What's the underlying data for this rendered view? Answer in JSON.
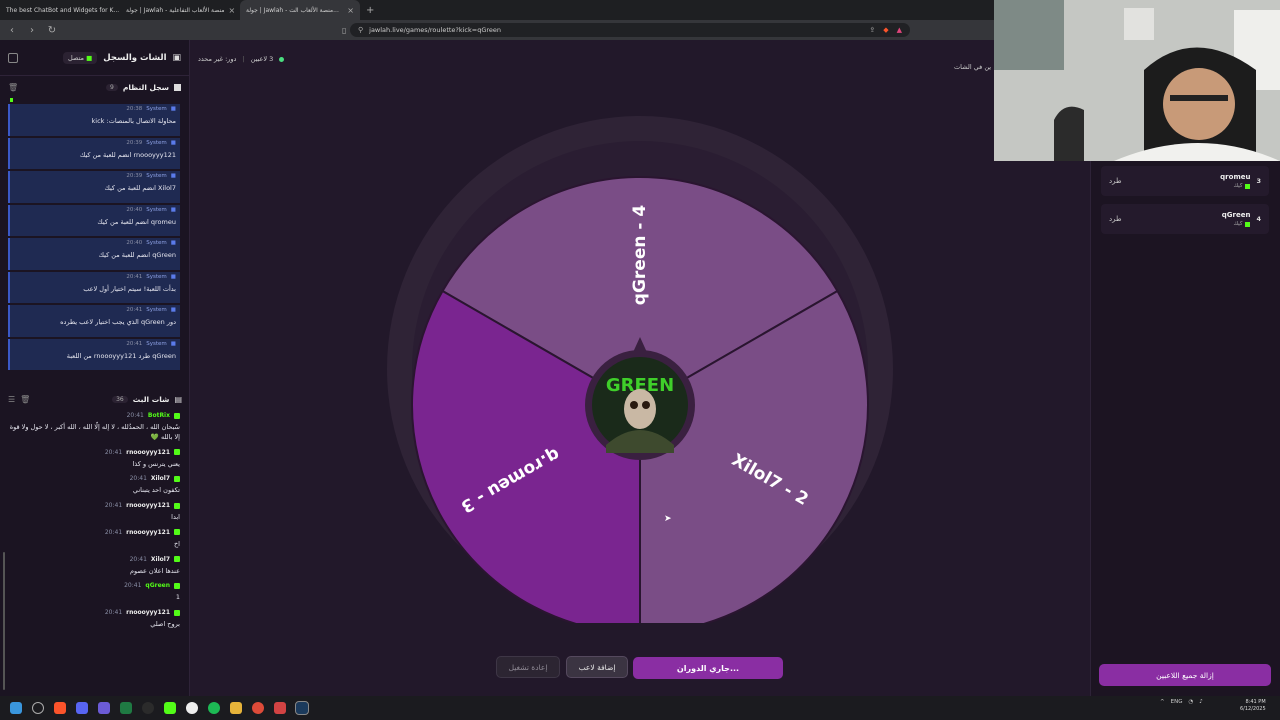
{
  "browser": {
    "tabs": [
      {
        "label": "The best ChatBot and Widgets for K..."
      },
      {
        "label": "جولة | Jawlah - منصة الألعاب التفاعلية"
      },
      {
        "label": "جولة | Jawlah - منصة الألعاب الت..."
      }
    ],
    "new_tab": "+",
    "url": "jawlah.live/games/roulette?kick=qGreen"
  },
  "left_panel": {
    "title": "الشات والسجل",
    "status": "متصل",
    "system_log": {
      "title": "سجل النظام",
      "count": "9",
      "items": [
        {
          "user": "System",
          "time": "20:38",
          "text": "محاولة الاتصال بالمنصات: kick"
        },
        {
          "user": "System",
          "time": "20:39",
          "text": "rnoooyyy121 انضم للعبة من كيك"
        },
        {
          "user": "System",
          "time": "20:39",
          "text": "Xilol7 انضم للعبة من كيك"
        },
        {
          "user": "System",
          "time": "20:40",
          "text": "qromeu انضم للعبة من كيك"
        },
        {
          "user": "System",
          "time": "20:40",
          "text": "qGreen انضم للعبة من كيك"
        },
        {
          "user": "System",
          "time": "20:41",
          "text": "بدأت اللعبة! سيتم اختيار أول لاعب"
        },
        {
          "user": "System",
          "time": "20:41",
          "text": "دور qGreen الذي يجب اختيار لاعب يطرده"
        },
        {
          "user": "System",
          "time": "20:41",
          "text": "qGreen طرد rnoooyyy121 من اللعبة"
        }
      ]
    },
    "stream_chat": {
      "title": "شات البث",
      "count": "36",
      "messages": [
        {
          "user": "BotRix",
          "time": "20:41",
          "text": "سُبحان الله ، الحمدُلله ، لا إله إلّا الله ، الله أكبر ، لا حول ولا قوة إلا بالله 💚"
        },
        {
          "user": "rnoooyyy121",
          "time": "20:41",
          "text": "يعني يترنس و كذا"
        },
        {
          "user": "Xilol7",
          "time": "20:41",
          "text": "تكفون احد يتبناني"
        },
        {
          "user": "rnoooyyy121",
          "time": "20:41",
          "text": "ابدا"
        },
        {
          "user": "rnoooyyy121",
          "time": "20:41",
          "text": "اخ"
        },
        {
          "user": "Xilol7",
          "time": "20:41",
          "text": "عندها اعلان عصوم"
        },
        {
          "user": "qGreen",
          "time": "20:41",
          "text": "1"
        },
        {
          "user": "rnoooyyy121",
          "time": "20:41",
          "text": "بروح اصلي"
        }
      ]
    }
  },
  "top": {
    "players_count": "3 لاعبين",
    "turn": "دور: غير محدد",
    "right_text": "ين في الشات"
  },
  "wheel": {
    "segments": [
      {
        "label": "qGreen - 4",
        "color": "#7a4d86"
      },
      {
        "label": "Xilol7 - 2",
        "color": "#7a4d86"
      },
      {
        "label": "q.romeu - 3",
        "color": "#7a2590"
      }
    ],
    "center_text": "GREEN"
  },
  "players": [
    {
      "num": "3",
      "name": "qromeu",
      "source": "كيك",
      "action": "طرد"
    },
    {
      "num": "4",
      "name": "qGreen",
      "source": "كيك",
      "action": "طرد"
    }
  ],
  "controls": {
    "restart": "إعادة تشغيل",
    "add_player": "إضافة لاعب",
    "spinning": "جاري الدوران...",
    "remove_all": "إزالة جميع اللاعبين"
  },
  "taskbar": {
    "tray_text": "ENG",
    "time": "8:41 PM",
    "date": "6/12/2025"
  },
  "colors": {
    "accent": "#8a2ea3",
    "kick_green": "#53fc18",
    "system_blue": "#1f2a52"
  }
}
